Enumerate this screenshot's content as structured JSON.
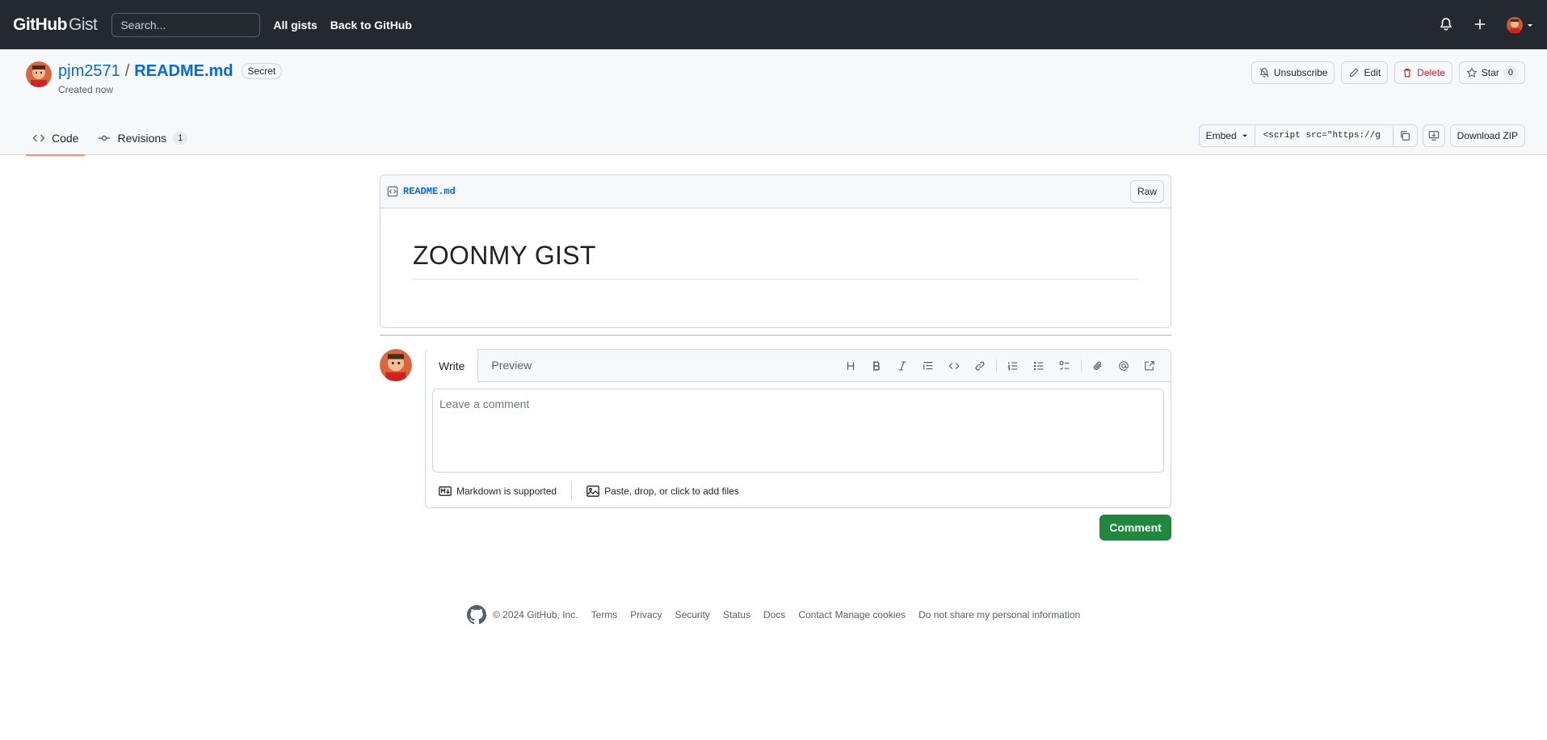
{
  "header": {
    "logo_primary": "GitHub",
    "logo_secondary": "Gist",
    "search_placeholder": "Search...",
    "nav": [
      "All gists",
      "Back to GitHub"
    ]
  },
  "gist": {
    "owner": "pjm2571",
    "separator": "/",
    "filename": "README.md",
    "visibility": "Secret",
    "created": "Created now",
    "actions": {
      "unsubscribe": "Unsubscribe",
      "edit": "Edit",
      "delete": "Delete",
      "star": "Star",
      "star_count": "0"
    },
    "tabs": {
      "code": "Code",
      "revisions": "Revisions",
      "revisions_count": "1"
    },
    "embed": {
      "label": "Embed",
      "value": "<script src=\"https://g"
    },
    "download": "Download ZIP"
  },
  "file": {
    "name": "README.md",
    "raw": "Raw",
    "heading": "ZOONMY GIST"
  },
  "comment": {
    "tab_write": "Write",
    "tab_preview": "Preview",
    "placeholder": "Leave a comment",
    "markdown_note": "Markdown is supported",
    "files_note": "Paste, drop, or click to add files",
    "submit": "Comment"
  },
  "footer": {
    "copyright": "© 2024 GitHub, Inc.",
    "links": [
      "Terms",
      "Privacy",
      "Security",
      "Status",
      "Docs",
      "Contact",
      "Manage cookies",
      "Do not share my personal information"
    ]
  },
  "colors": {
    "header_bg": "#24292f",
    "link": "#0969da",
    "danger": "#cf222e",
    "primary_button": "#1f883d",
    "tab_underline": "#fd8c73"
  }
}
